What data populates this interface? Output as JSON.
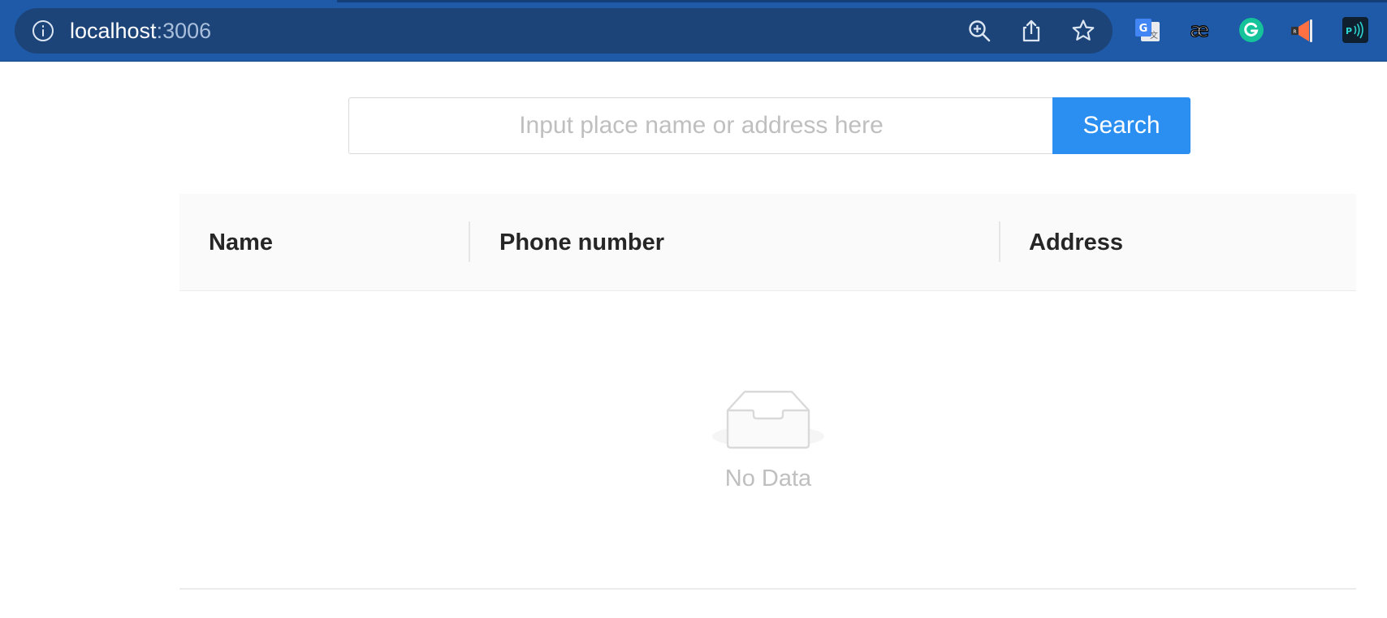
{
  "browser": {
    "url_host": "localhost",
    "url_port": ":3006",
    "icons": [
      "info-icon",
      "zoom-in-icon",
      "share-icon",
      "bookmark-star-icon"
    ],
    "extensions": [
      "google-translate-icon",
      "ae-extension-icon",
      "grammarly-icon",
      "megaphone-extension-icon",
      "sound-extension-icon"
    ],
    "colors": {
      "toolbar": "#1e5aa8",
      "omnibox": "#1c4478"
    }
  },
  "search": {
    "placeholder": "Input place name or address here",
    "value": "",
    "button_label": "Search",
    "button_color": "#2b8ff2"
  },
  "table": {
    "columns": [
      "Name",
      "Phone number",
      "Address"
    ],
    "rows": [],
    "empty_text": "No Data",
    "empty_icon": "empty-inbox-icon"
  }
}
